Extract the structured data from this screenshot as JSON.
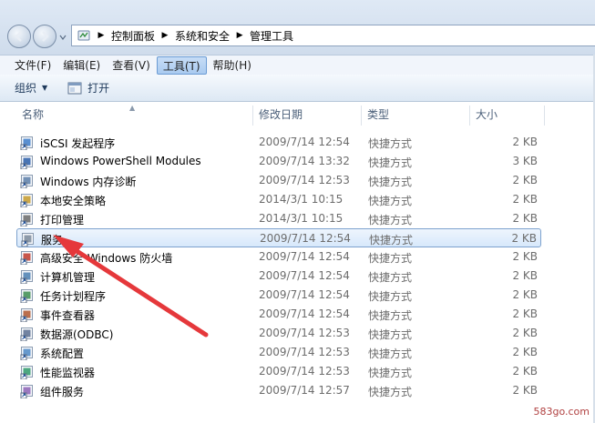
{
  "address": {
    "crumbs": [
      "控制面板",
      "系统和安全",
      "管理工具"
    ],
    "icon": "control-panel-icon"
  },
  "menu": [
    {
      "label": "文件(F)",
      "active": false
    },
    {
      "label": "编辑(E)",
      "active": false
    },
    {
      "label": "查看(V)",
      "active": false
    },
    {
      "label": "工具(T)",
      "active": true
    },
    {
      "label": "帮助(H)",
      "active": false
    }
  ],
  "toolbar": {
    "organize_label": "组织",
    "open_label": "打开"
  },
  "columns": {
    "name": "名称",
    "date": "修改日期",
    "type": "类型",
    "size": "大小"
  },
  "files": [
    {
      "name": "iSCSI 发起程序",
      "date": "2009/7/14 12:54",
      "type": "快捷方式",
      "size": "2 KB",
      "icon": "iscsi-icon"
    },
    {
      "name": "Windows PowerShell Modules",
      "date": "2009/7/14 13:32",
      "type": "快捷方式",
      "size": "3 KB",
      "icon": "powershell-icon"
    },
    {
      "name": "Windows 内存诊断",
      "date": "2009/7/14 12:53",
      "type": "快捷方式",
      "size": "2 KB",
      "icon": "memory-diagnostic-icon"
    },
    {
      "name": "本地安全策略",
      "date": "2014/3/1 10:15",
      "type": "快捷方式",
      "size": "2 KB",
      "icon": "security-policy-icon"
    },
    {
      "name": "打印管理",
      "date": "2014/3/1 10:15",
      "type": "快捷方式",
      "size": "2 KB",
      "icon": "print-management-icon"
    },
    {
      "name": "服务",
      "date": "2009/7/14 12:54",
      "type": "快捷方式",
      "size": "2 KB",
      "icon": "services-icon",
      "selected": true
    },
    {
      "name": "高级安全 Windows 防火墙",
      "date": "2009/7/14 12:54",
      "type": "快捷方式",
      "size": "2 KB",
      "icon": "firewall-icon"
    },
    {
      "name": "计算机管理",
      "date": "2009/7/14 12:54",
      "type": "快捷方式",
      "size": "2 KB",
      "icon": "computer-management-icon"
    },
    {
      "name": "任务计划程序",
      "date": "2009/7/14 12:54",
      "type": "快捷方式",
      "size": "2 KB",
      "icon": "task-scheduler-icon"
    },
    {
      "name": "事件查看器",
      "date": "2009/7/14 12:54",
      "type": "快捷方式",
      "size": "2 KB",
      "icon": "event-viewer-icon"
    },
    {
      "name": "数据源(ODBC)",
      "date": "2009/7/14 12:53",
      "type": "快捷方式",
      "size": "2 KB",
      "icon": "odbc-icon"
    },
    {
      "name": "系统配置",
      "date": "2009/7/14 12:53",
      "type": "快捷方式",
      "size": "2 KB",
      "icon": "system-config-icon"
    },
    {
      "name": "性能监视器",
      "date": "2009/7/14 12:53",
      "type": "快捷方式",
      "size": "2 KB",
      "icon": "performance-monitor-icon"
    },
    {
      "name": "组件服务",
      "date": "2009/7/14 12:57",
      "type": "快捷方式",
      "size": "2 KB",
      "icon": "component-services-icon"
    }
  ],
  "annotation": {
    "arrow_color": "#e5383b",
    "target": "服务"
  },
  "watermark": "583go.com"
}
